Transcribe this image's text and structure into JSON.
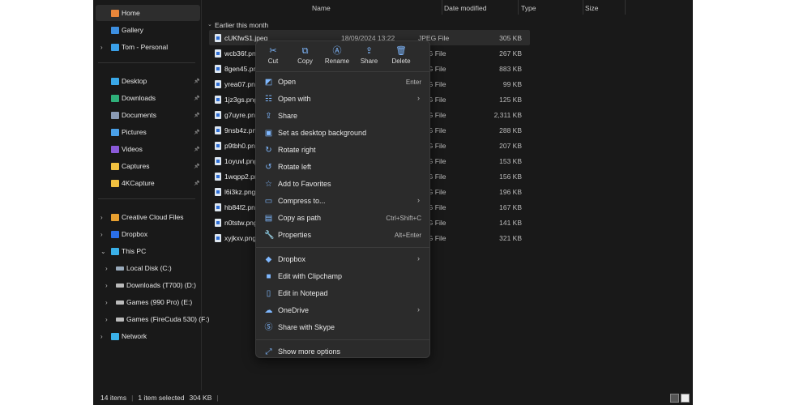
{
  "sidebar": {
    "items": [
      {
        "label": "Home",
        "icon": "home-icon",
        "color": "#e8863a",
        "selected": true
      },
      {
        "label": "Gallery",
        "icon": "gallery-icon",
        "color": "#3d8fe0"
      },
      {
        "label": "Tom - Personal",
        "icon": "onedrive-folder-icon",
        "color": "#3aa0e8",
        "chevron": true
      },
      {
        "label": "Desktop",
        "icon": "desktop-folder-icon",
        "color": "#3aa8e8",
        "pinned": true
      },
      {
        "label": "Downloads",
        "icon": "downloads-folder-icon",
        "color": "#2fb07a",
        "pinned": true
      },
      {
        "label": "Documents",
        "icon": "documents-folder-icon",
        "color": "#8a9bb5",
        "pinned": true
      },
      {
        "label": "Pictures",
        "icon": "pictures-folder-icon",
        "color": "#4aa0e8",
        "pinned": true
      },
      {
        "label": "Videos",
        "icon": "videos-folder-icon",
        "color": "#8a5ad8",
        "pinned": true
      },
      {
        "label": "Captures",
        "icon": "folder-icon",
        "color": "#f0c040",
        "pinned": true
      },
      {
        "label": "4KCapture",
        "icon": "folder-icon",
        "color": "#f0c040",
        "pinned": true
      },
      {
        "label": "Creative Cloud Files",
        "icon": "creative-cloud-icon",
        "color": "#e8a030",
        "chevron": true
      },
      {
        "label": "Dropbox",
        "icon": "dropbox-icon",
        "color": "#2a6ee8",
        "chevron": true
      },
      {
        "label": "This PC",
        "icon": "pc-icon",
        "color": "#3ab0e8",
        "chevron": true,
        "expanded": true
      },
      {
        "label": "Local Disk (C:)",
        "icon": "drive-icon",
        "color": "#9ab",
        "chevron": true
      },
      {
        "label": "Downloads (T700) (D:)",
        "icon": "drive-icon",
        "color": "#bbb",
        "chevron": true
      },
      {
        "label": "Games (990 Pro) (E:)",
        "icon": "drive-icon",
        "color": "#bbb",
        "chevron": true
      },
      {
        "label": "Games (FireCuda 530) (F:)",
        "icon": "drive-icon",
        "color": "#bbb",
        "chevron": true
      },
      {
        "label": "Network",
        "icon": "network-icon",
        "color": "#3ab0e8",
        "chevron": true
      }
    ]
  },
  "columns": {
    "name": "Name",
    "date": "Date modified",
    "type": "Type",
    "size": "Size"
  },
  "group": "Earlier this month",
  "files": [
    {
      "name": "cUKfwS1.jpeg",
      "date": "18/09/2024 13:22",
      "type": "JPEG File",
      "size": "305 KB"
    },
    {
      "name": "wcb36f.png",
      "type": "PNG File",
      "size": "267 KB"
    },
    {
      "name": "8gen45.png",
      "type": "PNG File",
      "size": "883 KB"
    },
    {
      "name": "yrea07.png",
      "type": "PNG File",
      "size": "99 KB"
    },
    {
      "name": "1jz3gs.png",
      "type": "PNG File",
      "size": "125 KB"
    },
    {
      "name": "g7uyre.png",
      "type": "PNG File",
      "size": "2,311 KB"
    },
    {
      "name": "9nsb4z.png",
      "type": "PNG File",
      "size": "288 KB"
    },
    {
      "name": "p9tbh0.png",
      "type": "PNG File",
      "size": "207 KB"
    },
    {
      "name": "1oyuvl.png",
      "type": "PNG File",
      "size": "153 KB"
    },
    {
      "name": "1wqpp2.png",
      "type": "PNG File",
      "size": "156 KB"
    },
    {
      "name": "l6i3kz.png",
      "type": "PNG File",
      "size": "196 KB"
    },
    {
      "name": "hb84f2.png",
      "type": "PNG File",
      "size": "167 KB"
    },
    {
      "name": "n0tstw.png",
      "type": "PNG File",
      "size": "141 KB"
    },
    {
      "name": "xyjkxv.png",
      "type": "PNG File",
      "size": "321 KB"
    }
  ],
  "status": {
    "count": "14 items",
    "selected": "1 item selected",
    "size": "304 KB"
  },
  "menu": {
    "toolbar": [
      {
        "label": "Cut",
        "icon": "cut-icon",
        "glyph": "✂"
      },
      {
        "label": "Copy",
        "icon": "copy-icon",
        "glyph": "⧉"
      },
      {
        "label": "Rename",
        "icon": "rename-icon",
        "glyph": "Ⓐ"
      },
      {
        "label": "Share",
        "icon": "share-icon",
        "glyph": "⇪"
      },
      {
        "label": "Delete",
        "icon": "delete-icon",
        "glyph": "🗑"
      }
    ],
    "groups": [
      [
        {
          "label": "Open",
          "shortcut": "Enter",
          "icon": "open-icon",
          "glyph": "◩"
        },
        {
          "label": "Open with",
          "submenu": true,
          "icon": "open-with-icon",
          "glyph": "☷"
        },
        {
          "label": "Share",
          "icon": "share-icon",
          "glyph": "⇪"
        },
        {
          "label": "Set as desktop background",
          "icon": "desktop-background-icon",
          "glyph": "▣"
        },
        {
          "label": "Rotate right",
          "icon": "rotate-right-icon",
          "glyph": "↻"
        },
        {
          "label": "Rotate left",
          "icon": "rotate-left-icon",
          "glyph": "↺"
        },
        {
          "label": "Add to Favorites",
          "icon": "star-icon",
          "glyph": "☆"
        },
        {
          "label": "Compress to...",
          "submenu": true,
          "icon": "compress-icon",
          "glyph": "▭"
        },
        {
          "label": "Copy as path",
          "shortcut": "Ctrl+Shift+C",
          "icon": "copy-path-icon",
          "glyph": "▤"
        },
        {
          "label": "Properties",
          "shortcut": "Alt+Enter",
          "icon": "wrench-icon",
          "glyph": "🔧"
        }
      ],
      [
        {
          "label": "Dropbox",
          "submenu": true,
          "icon": "dropbox-icon",
          "glyph": "◆"
        },
        {
          "label": "Edit with Clipchamp",
          "icon": "clipchamp-icon",
          "glyph": "■"
        },
        {
          "label": "Edit in Notepad",
          "icon": "notepad-icon",
          "glyph": "▯"
        },
        {
          "label": "OneDrive",
          "submenu": true,
          "icon": "onedrive-icon",
          "glyph": "☁"
        },
        {
          "label": "Share with Skype",
          "icon": "skype-icon",
          "glyph": "Ⓢ"
        }
      ],
      [
        {
          "label": "Show more options",
          "icon": "more-options-icon",
          "glyph": "⤢"
        }
      ]
    ]
  }
}
